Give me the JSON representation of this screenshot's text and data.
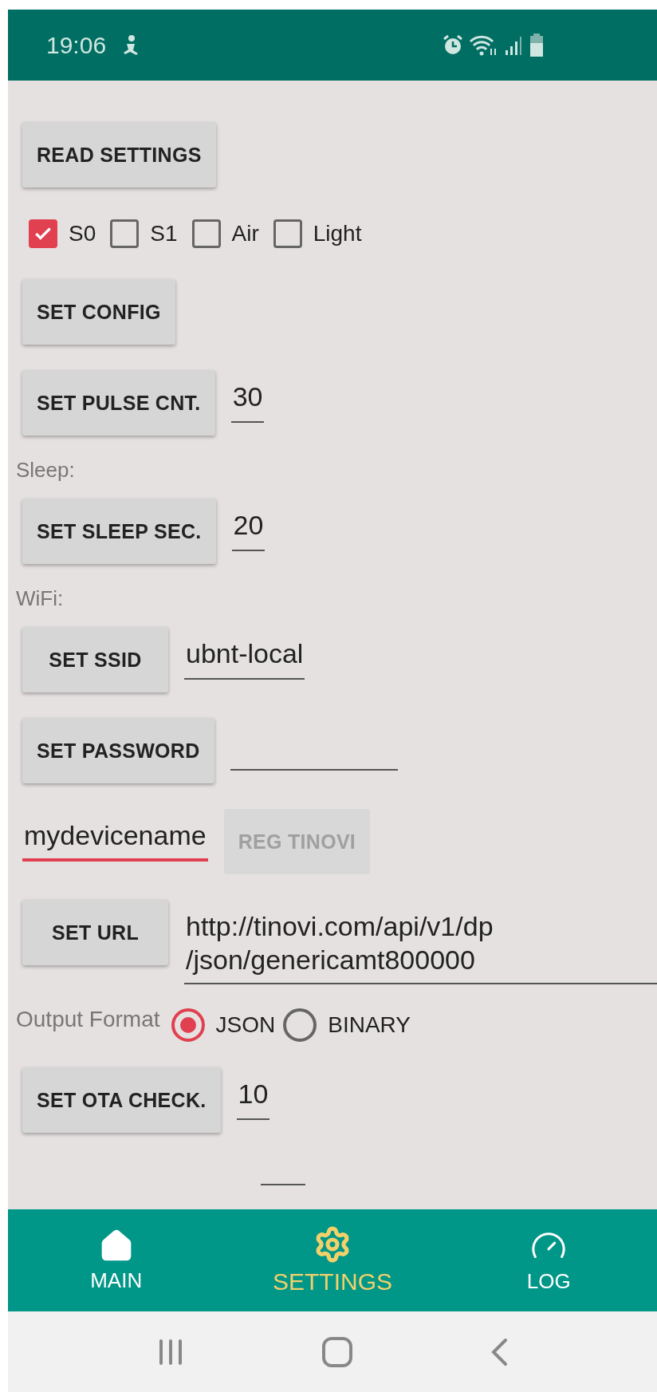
{
  "status_bar": {
    "time": "19:06"
  },
  "settings": [
    {
      "kind": "button",
      "button": {
        "label": "READ SETTINGS",
        "disabled": false
      }
    },
    {
      "kind": "checkboxes",
      "items": [
        {
          "label": "S0",
          "checked": true
        },
        {
          "label": "S1",
          "checked": false
        },
        {
          "label": "Air",
          "checked": false
        },
        {
          "label": "Light",
          "checked": false
        }
      ]
    },
    {
      "kind": "button",
      "button": {
        "label": "SET CONFIG",
        "disabled": false
      }
    },
    {
      "kind": "button_field",
      "button": {
        "label": "SET PULSE CNT.",
        "disabled": false
      },
      "field": {
        "value": "30",
        "focused": false
      }
    },
    {
      "kind": "caption",
      "text": "Sleep:"
    },
    {
      "kind": "button_field",
      "button": {
        "label": "SET SLEEP SEC.",
        "disabled": false
      },
      "field": {
        "value": "20",
        "focused": false
      }
    },
    {
      "kind": "caption",
      "text": "WiFi:"
    },
    {
      "kind": "button_field",
      "button": {
        "label": "SET SSID",
        "disabled": false
      },
      "field": {
        "value": "ubnt-local",
        "focused": false
      }
    },
    {
      "kind": "button_field",
      "button": {
        "label": "SET PASSWORD",
        "disabled": false
      },
      "field": {
        "focused": false
      }
    },
    {
      "kind": "field_button",
      "field": {
        "value": "mydevicename",
        "focused": true
      },
      "button": {
        "label": "REG TINOVI",
        "disabled": true
      }
    },
    {
      "kind": "button_field",
      "button": {
        "label": "SET URL",
        "disabled": false
      },
      "field": {
        "lines": [
          "http://tinovi.com/api/v1/dp",
          "/json/genericamt800000"
        ],
        "focused": false
      }
    },
    {
      "kind": "radio",
      "label": "Output Format",
      "options": [
        {
          "label": "JSON",
          "selected": true
        },
        {
          "label": "BINARY",
          "selected": false
        }
      ]
    },
    {
      "kind": "button_field",
      "button": {
        "label": "SET OTA CHECK.",
        "disabled": false
      },
      "field": {
        "value": "10",
        "focused": false
      }
    },
    {
      "kind": "field"
    }
  ],
  "bottom_nav": [
    {
      "label": "MAIN",
      "kind": "home",
      "selected": false
    },
    {
      "label": "SETTINGS",
      "kind": "settings",
      "selected": true
    },
    {
      "label": "LOG",
      "kind": "gauge",
      "selected": false
    }
  ]
}
